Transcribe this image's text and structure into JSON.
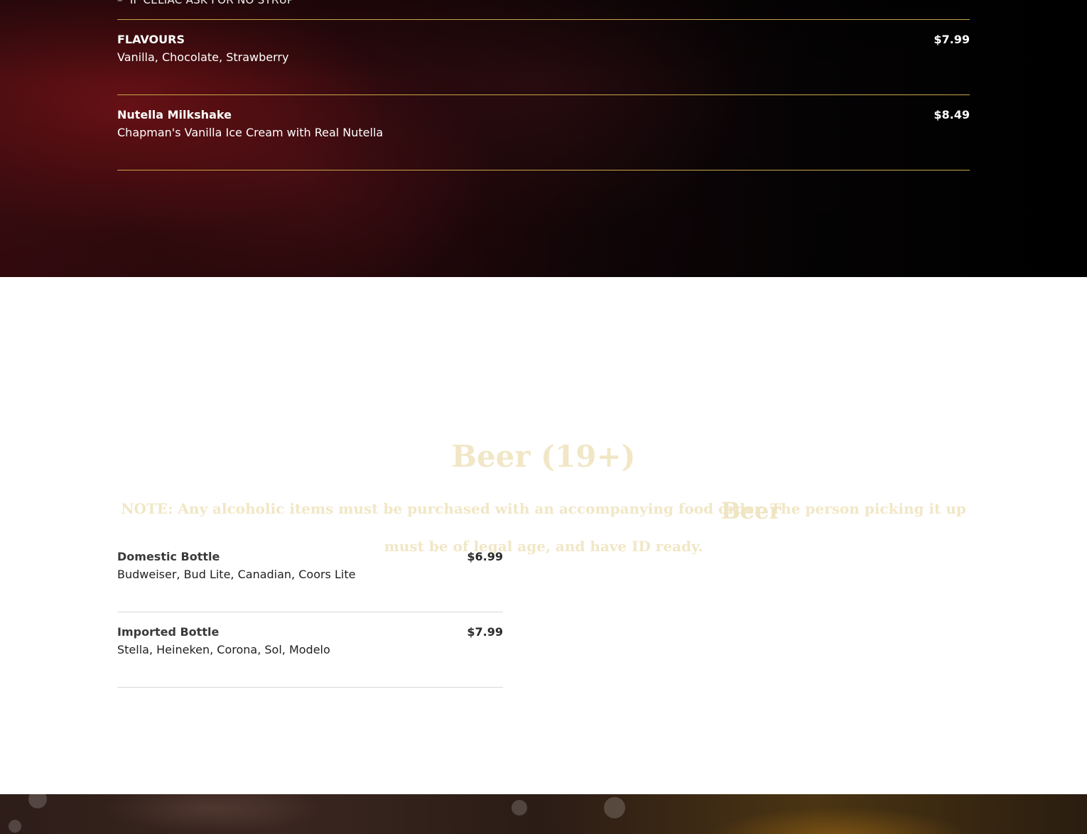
{
  "dark_menu": {
    "cut_off_note": "IF CELIAC ASK FOR NO SYRUP",
    "items": [
      {
        "name": "FLAVOURS",
        "description": "Vanilla, Chocolate, Strawberry",
        "price": "$7.99"
      },
      {
        "name": "Nutella Milkshake",
        "description": "Chapman's Vanilla Ice Cream with Real Nutella",
        "price": "$8.49"
      }
    ]
  },
  "beer_section": {
    "title": "Beer (19+)",
    "note": "NOTE: Any alcoholic items must be purchased with an accompanying food order. The person picking it up must be of legal age, and have ID ready.",
    "subtitle": "Beer",
    "items": [
      {
        "name": "Domestic Bottle",
        "description": "Budweiser, Bud Lite, Canadian, Coors Lite",
        "price": "$6.99"
      },
      {
        "name": "Imported Bottle",
        "description": "Stella, Heineken, Corona, Sol, Modelo",
        "price": "$7.99"
      }
    ]
  },
  "colors": {
    "gold_rule": "#c9a44a",
    "cream_heading": "#f1e7c6",
    "dark_text": "#2b2b2b"
  }
}
